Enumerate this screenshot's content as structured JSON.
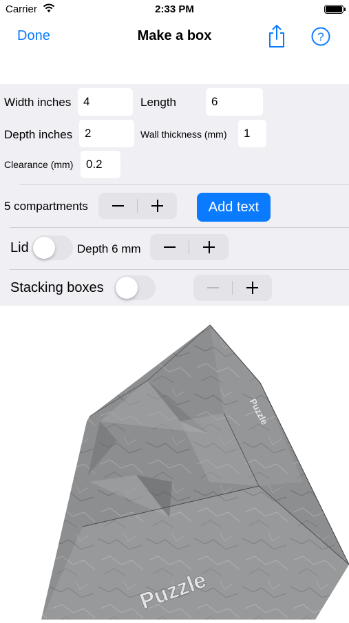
{
  "status_bar": {
    "carrier": "Carrier",
    "time": "2:33 PM"
  },
  "nav": {
    "done_label": "Done",
    "title": "Make a box",
    "share_icon": "share-icon",
    "help_icon": "help-icon"
  },
  "form": {
    "width_label": "Width inches",
    "width_value": "4",
    "length_label": "Length",
    "length_value": "6",
    "depth_label": "Depth inches",
    "depth_value": "2",
    "wall_label": "Wall thickness (mm)",
    "wall_value": "1",
    "clearance_label": "Clearance (mm)",
    "clearance_value": "0.2"
  },
  "compartments": {
    "label": "5 compartments",
    "add_text_label": "Add text"
  },
  "lid": {
    "label": "Lid",
    "on": false,
    "depth_label": "Depth 6 mm"
  },
  "stacking": {
    "label": "Stacking boxes",
    "on": false
  },
  "preview": {
    "front_text": "Puzzle",
    "side_text": "Puzzle"
  },
  "colors": {
    "accent": "#0a7aff",
    "panel": "#efeff4",
    "stone": "#8d8e90"
  }
}
